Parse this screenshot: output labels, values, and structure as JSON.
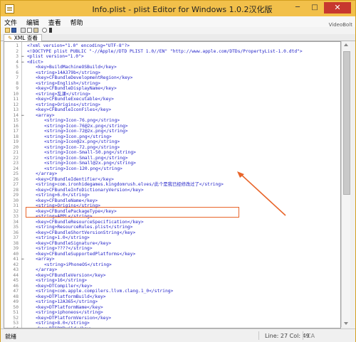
{
  "window": {
    "title": "Info.plist - plist Editor for Windows 1.0.2汉化版",
    "min_label": "─",
    "max_label": "□",
    "close_label": "✕"
  },
  "menu": [
    {
      "label": "文件"
    },
    {
      "label": "编辑"
    },
    {
      "label": "查看"
    },
    {
      "label": "帮助"
    }
  ],
  "brand": "VideoBolt",
  "tab": {
    "label": "XML 查看"
  },
  "editor": {
    "lines": [
      {
        "n": "1",
        "fold": "",
        "indent": 0,
        "text": "<?xml version=\"1.0\" encoding=\"UTF-8\"?>"
      },
      {
        "n": "2",
        "fold": "",
        "indent": 0,
        "text": "<!DOCTYPE plist PUBLIC \"-//Apple//DTD PLIST 1.0//EN\" \"http://www.apple.com/DTDs/PropertyList-1.0.dtd\">"
      },
      {
        "n": "3",
        "fold": "−",
        "indent": 0,
        "text": "<plist version=\"1.0\">"
      },
      {
        "n": "4",
        "fold": "−",
        "indent": 0,
        "text": "<dict>"
      },
      {
        "n": "5",
        "fold": "",
        "indent": 1,
        "text": "<key>BuildMachineOSBuild</key>"
      },
      {
        "n": "6",
        "fold": "",
        "indent": 1,
        "text": "<string>14A379b</string>"
      },
      {
        "n": "7",
        "fold": "",
        "indent": 1,
        "text": "<key>CFBundleDevelopmentRegion</key>"
      },
      {
        "n": "8",
        "fold": "",
        "indent": 1,
        "text": "<string>English</string>"
      },
      {
        "n": "9",
        "fold": "",
        "indent": 1,
        "text": "<key>CFBundleDisplayName</key>"
      },
      {
        "n": "10",
        "fold": "",
        "indent": 1,
        "text": "<string>乱课</string>"
      },
      {
        "n": "11",
        "fold": "",
        "indent": 1,
        "text": "<key>CFBundleExecutable</key>"
      },
      {
        "n": "12",
        "fold": "",
        "indent": 1,
        "text": "<string>Origins</string>"
      },
      {
        "n": "13",
        "fold": "",
        "indent": 1,
        "text": "<key>CFBundleIconFiles</key>"
      },
      {
        "n": "14",
        "fold": "−",
        "indent": 1,
        "text": "<array>"
      },
      {
        "n": "15",
        "fold": "",
        "indent": 2,
        "text": "<string>Icon-76.png</string>"
      },
      {
        "n": "16",
        "fold": "",
        "indent": 2,
        "text": "<string>Icon-76@2x.png</string>"
      },
      {
        "n": "17",
        "fold": "",
        "indent": 2,
        "text": "<string>Icon-72@2x.png</string>"
      },
      {
        "n": "18",
        "fold": "",
        "indent": 2,
        "text": "<string>Icon.png</string>"
      },
      {
        "n": "19",
        "fold": "",
        "indent": 2,
        "text": "<string>Icon@2x.png</string>"
      },
      {
        "n": "20",
        "fold": "",
        "indent": 2,
        "text": "<string>Icon-72.png</string>"
      },
      {
        "n": "21",
        "fold": "",
        "indent": 2,
        "text": "<string>Icon-Small-50.png</string>"
      },
      {
        "n": "22",
        "fold": "",
        "indent": 2,
        "text": "<string>Icon-Small.png</string>"
      },
      {
        "n": "23",
        "fold": "",
        "indent": 2,
        "text": "<string>Icon-Small@2x.png</string>"
      },
      {
        "n": "24",
        "fold": "",
        "indent": 2,
        "text": "<string>Icon-120.png</string>"
      },
      {
        "n": "25",
        "fold": "",
        "indent": 1,
        "text": "</array>"
      },
      {
        "n": "26",
        "fold": "",
        "indent": 1,
        "text": "<key>CFBundleIdentifier</key>"
      },
      {
        "n": "27",
        "fold": "",
        "indent": 1,
        "text": "<string>com.ironhidegames.kingdomrush.elves/此个是我已经修改过了</string>"
      },
      {
        "n": "28",
        "fold": "",
        "indent": 1,
        "text": "<key>CFBundleInfoDictionaryVersion</key>"
      },
      {
        "n": "29",
        "fold": "",
        "indent": 1,
        "text": "<string>6.0</string>"
      },
      {
        "n": "30",
        "fold": "",
        "indent": 1,
        "text": "<key>CFBundleName</key>"
      },
      {
        "n": "31",
        "fold": "",
        "indent": 1,
        "text": "<string>Origins</string>"
      },
      {
        "n": "32",
        "fold": "",
        "indent": 1,
        "text": "<key>CFBundlePackageType</key>"
      },
      {
        "n": "33",
        "fold": "",
        "indent": 1,
        "text": "<string>APPL</string>"
      },
      {
        "n": "34",
        "fold": "",
        "indent": 1,
        "text": "<key>CFBundleResourceSpecification</key>"
      },
      {
        "n": "35",
        "fold": "",
        "indent": 1,
        "text": "<string>ResourceRules.plist</string>"
      },
      {
        "n": "36",
        "fold": "",
        "indent": 1,
        "text": "<key>CFBundleShortVersionString</key>"
      },
      {
        "n": "37",
        "fold": "",
        "indent": 1,
        "text": "<string>1.0</string>"
      },
      {
        "n": "38",
        "fold": "",
        "indent": 1,
        "text": "<key>CFBundleSignature</key>"
      },
      {
        "n": "39",
        "fold": "",
        "indent": 1,
        "text": "<string>????</string>"
      },
      {
        "n": "40",
        "fold": "",
        "indent": 1,
        "text": "<key>CFBundleSupportedPlatforms</key>"
      },
      {
        "n": "41",
        "fold": "−",
        "indent": 1,
        "text": "<array>"
      },
      {
        "n": "42",
        "fold": "",
        "indent": 2,
        "text": "<string>iPhoneOS</string>"
      },
      {
        "n": "43",
        "fold": "",
        "indent": 1,
        "text": "</array>"
      },
      {
        "n": "44",
        "fold": "",
        "indent": 1,
        "text": "<key>CFBundleVersion</key>"
      },
      {
        "n": "45",
        "fold": "",
        "indent": 1,
        "text": "<string>16</string>"
      },
      {
        "n": "46",
        "fold": "",
        "indent": 1,
        "text": "<key>DTCompiler</key>"
      },
      {
        "n": "47",
        "fold": "",
        "indent": 1,
        "text": "<string>com.apple.compilers.llvm.clang.1_0</string>"
      },
      {
        "n": "48",
        "fold": "",
        "indent": 1,
        "text": "<key>DTPlatformBuild</key>"
      },
      {
        "n": "49",
        "fold": "",
        "indent": 1,
        "text": "<string>12A365</string>"
      },
      {
        "n": "50",
        "fold": "",
        "indent": 1,
        "text": "<key>DTPlatformName</key>"
      },
      {
        "n": "51",
        "fold": "",
        "indent": 1,
        "text": "<string>iphoneos</string>"
      },
      {
        "n": "52",
        "fold": "",
        "indent": 1,
        "text": "<key>DTPlatformVersion</key>"
      },
      {
        "n": "53",
        "fold": "",
        "indent": 1,
        "text": "<string>8.0</string>"
      },
      {
        "n": "54",
        "fold": "",
        "indent": 1,
        "text": "<key>DTSDKBuild</key>"
      },
      {
        "n": "55",
        "fold": "",
        "indent": 1,
        "text": "<string>12A365</string>"
      },
      {
        "n": "56",
        "fold": "",
        "indent": 1,
        "text": "<key>DTSDKName</key>"
      },
      {
        "n": "57",
        "fold": "",
        "indent": 1,
        "text": "<string>iphoneos8.0</string>"
      },
      {
        "n": "58",
        "fold": "",
        "indent": 1,
        "text": "<key>DTXcode</key>"
      }
    ]
  },
  "status": {
    "left": "就绪",
    "position": "Line: 27 Col: 49",
    "caps": "CA"
  },
  "colors": {
    "title_bar": "#f2c04a",
    "highlight": "#e8652a",
    "tag": "#2323c8"
  }
}
